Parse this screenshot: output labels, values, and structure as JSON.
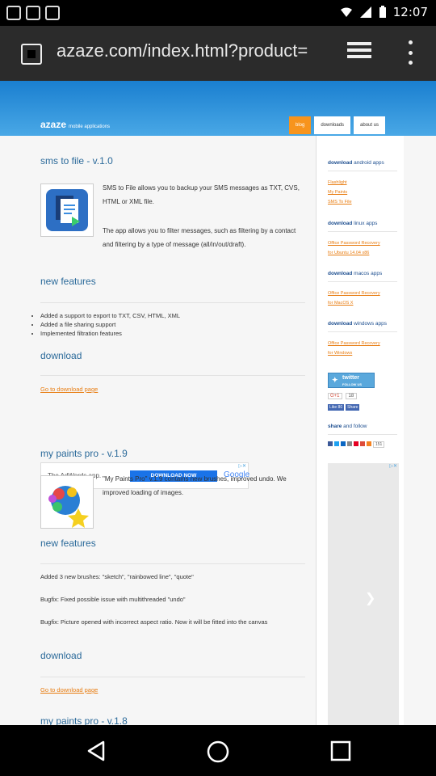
{
  "status_bar": {
    "time": "12:07"
  },
  "browser": {
    "url": "azaze.com/index.html?product="
  },
  "site": {
    "logo": "azaze",
    "logo_tagline": "mobile applications",
    "nav": [
      "blog",
      "downloads",
      "about us"
    ]
  },
  "main": {
    "sms": {
      "title": "sms to file - v.1.0",
      "desc1": "SMS to File allows you to backup your SMS messages as TXT, CVS, HTML or XML file.",
      "desc2": "The app allows you to filter messages, such as filtering by a contact and filtering by a type of message (all/in/out/draft).",
      "features_title": "new features",
      "features": [
        "Added a support to export to TXT, CSV, HTML, XML",
        "Added a file sharing support",
        "Implemented filtration features"
      ],
      "download_title": "download",
      "download_link": "Go to download page"
    },
    "ad": {
      "text": "The AdWords app.",
      "button": "DOWNLOAD NOW",
      "brand": "Google"
    },
    "paints": {
      "title": "my paints pro - v.1.9",
      "desc": "\"My Paints Pro\" v.1.9 contains new brushes, improved undo. We improved loading of images.",
      "features_title": "new features",
      "features": [
        "Added 3 new brushes: \"sketch\", \"rainbowed line\", \"quote\"",
        "Bugfix: Fixed possible issue with multithreaded \"undo\"",
        "Bugfix: Picture opened with incorrect aspect ratio. Now it will be fitted into the canvas"
      ],
      "download_title": "download",
      "download_link": "Go to download page"
    },
    "next_title": "my paints pro - v.1.8"
  },
  "sidebar": {
    "android_h1": "download",
    "android_h2": "android apps",
    "android_links": [
      "Flashlight",
      "My Paints",
      "SMS To File"
    ],
    "linux_h1": "download",
    "linux_h2": "linux apps",
    "linux_links": [
      "Office Password Recovery",
      "for Ubuntu 14.04 x86"
    ],
    "macos_h1": "download",
    "macos_h2": "macos apps",
    "macos_links": [
      "Office Password Recovery",
      "for MacOS X"
    ],
    "windows_h1": "download",
    "windows_h2": "windows apps",
    "windows_links": [
      "Office Password Recovery",
      "for Windows"
    ],
    "twitter": "twitter",
    "twitter_sub": "FOLLOW US",
    "gplus_label": "G+1",
    "gplus_count": "18",
    "fb_like": "Like 80",
    "fb_share": "Share",
    "share_h1": "share",
    "share_h2": "and follow",
    "share_count": "151"
  }
}
